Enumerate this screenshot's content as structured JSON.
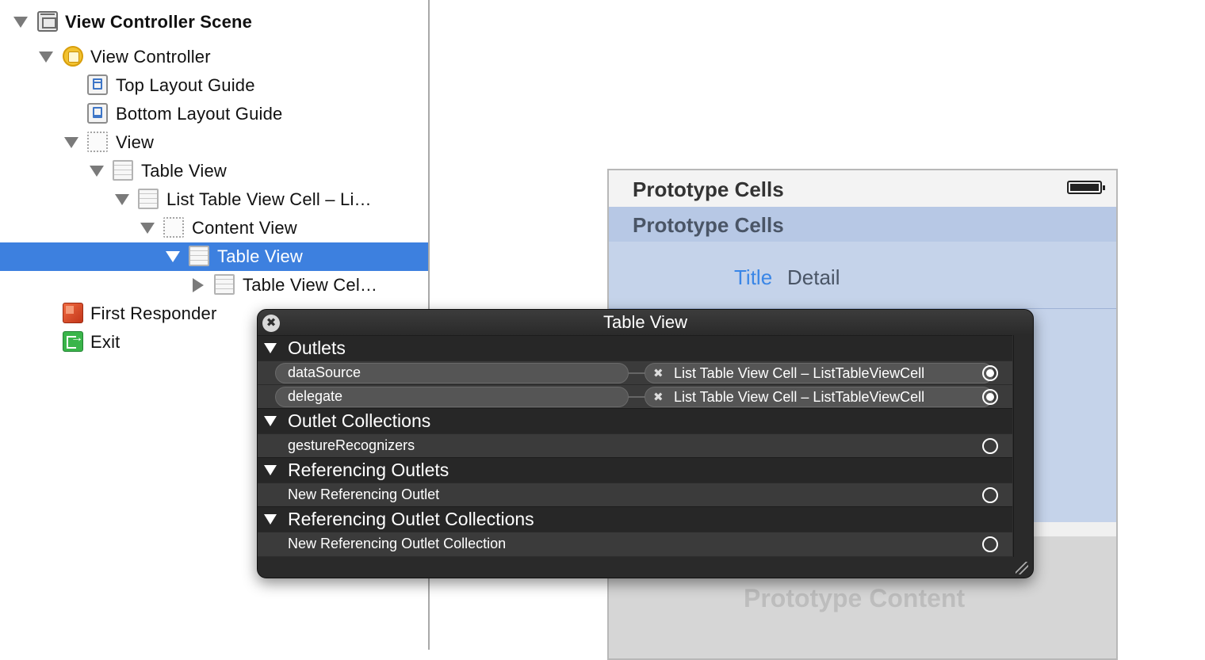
{
  "outline": {
    "items": [
      {
        "label": "View Controller Scene",
        "icon": "scene-icon",
        "expanded": true
      },
      {
        "label": "View Controller",
        "icon": "view-controller-icon",
        "expanded": true
      },
      {
        "label": "Top Layout Guide",
        "icon": "top-layout-guide-icon"
      },
      {
        "label": "Bottom Layout Guide",
        "icon": "bottom-layout-guide-icon"
      },
      {
        "label": "View",
        "icon": "view-icon",
        "expanded": true
      },
      {
        "label": "Table View",
        "icon": "table-view-icon",
        "expanded": true
      },
      {
        "label": "List Table View Cell – Li…",
        "icon": "table-view-cell-icon",
        "expanded": true
      },
      {
        "label": "Content View",
        "icon": "content-view-icon",
        "expanded": true
      },
      {
        "label": "Table View",
        "icon": "table-view-icon",
        "expanded": true,
        "selected": true
      },
      {
        "label": "Table View Cel…",
        "icon": "table-view-cell-icon",
        "expanded": false
      },
      {
        "label": "First Responder",
        "icon": "first-responder-icon"
      },
      {
        "label": "Exit",
        "icon": "exit-icon"
      }
    ]
  },
  "canvas": {
    "status_bar_title": "Prototype Cells",
    "section_header": "Prototype Cells",
    "cell_title": "Title",
    "cell_detail": "Detail",
    "prototype_content": "Prototype Content"
  },
  "hud": {
    "title": "Table View",
    "close_glyph": "✖",
    "sections": {
      "outlets": "Outlets",
      "outlet_collections": "Outlet Collections",
      "referencing_outlets": "Referencing Outlets",
      "referencing_outlet_collections": "Referencing Outlet Collections"
    },
    "outlets": [
      {
        "name": "dataSource",
        "target": "List Table View Cell – ListTableViewCell",
        "connected": true
      },
      {
        "name": "delegate",
        "target": "List Table View Cell – ListTableViewCell",
        "connected": true
      }
    ],
    "outlet_collections": [
      {
        "name": "gestureRecognizers",
        "connected": false
      }
    ],
    "referencing_outlets": [
      {
        "name": "New Referencing Outlet",
        "connected": false
      }
    ],
    "referencing_outlet_collections": [
      {
        "name": "New Referencing Outlet Collection",
        "connected": false
      }
    ],
    "disconnect_glyph": "✖"
  },
  "colors": {
    "selection": "#3d80df",
    "hud_background": "#2e2e2e",
    "cell_title": "#3a86e6",
    "canvas_blue": "#c5d3ea"
  }
}
